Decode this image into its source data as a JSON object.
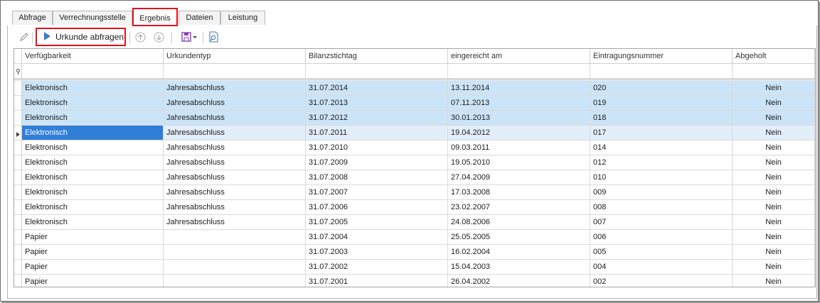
{
  "tabs": [
    {
      "label": "Abfrage"
    },
    {
      "label": "Verrechnungsstelle"
    },
    {
      "label": "Ergebnis"
    },
    {
      "label": "Dateien"
    },
    {
      "label": "Leistung"
    }
  ],
  "active_tab": "Ergebnis",
  "toolbar": {
    "run_label": "Urkunde abfragen",
    "icons": [
      "pencil-icon",
      "play-icon",
      "arrow-up-icon",
      "arrow-down-icon",
      "save-dropdown-icon",
      "search-document-icon"
    ]
  },
  "grid": {
    "columns": [
      "Verfügbarkeit",
      "Urkundentyp",
      "Bilanzstichtag",
      "eingereicht am",
      "Eintragungsnummer",
      "Abgeholt"
    ],
    "rows": [
      [
        "Elektronisch",
        "Jahresabschluss",
        "31.07.2014",
        "13.11.2014",
        "020",
        "Nein"
      ],
      [
        "Elektronisch",
        "Jahresabschluss",
        "31.07.2013",
        "07.11.2013",
        "019",
        "Nein"
      ],
      [
        "Elektronisch",
        "Jahresabschluss",
        "31.07.2012",
        "30.01.2013",
        "018",
        "Nein"
      ],
      [
        "Elektronisch",
        "Jahresabschluss",
        "31.07.2011",
        "19.04.2012",
        "017",
        "Nein"
      ],
      [
        "Elektronisch",
        "Jahresabschluss",
        "31.07.2010",
        "09.03.2011",
        "014",
        "Nein"
      ],
      [
        "Elektronisch",
        "Jahresabschluss",
        "31.07.2009",
        "19.05.2010",
        "012",
        "Nein"
      ],
      [
        "Elektronisch",
        "Jahresabschluss",
        "31.07.2008",
        "27.04.2009",
        "010",
        "Nein"
      ],
      [
        "Elektronisch",
        "Jahresabschluss",
        "31.07.2007",
        "17.03.2008",
        "009",
        "Nein"
      ],
      [
        "Elektronisch",
        "Jahresabschluss",
        "31.07.2006",
        "23.02.2007",
        "008",
        "Nein"
      ],
      [
        "Elektronisch",
        "Jahresabschluss",
        "31.07.2005",
        "24.08.2006",
        "007",
        "Nein"
      ],
      [
        "Papier",
        "",
        "31.07.2004",
        "25.05.2005",
        "006",
        "Nein"
      ],
      [
        "Papier",
        "",
        "31.07.2003",
        "16.02.2004",
        "005",
        "Nein"
      ],
      [
        "Papier",
        "",
        "31.07.2002",
        "15.04.2003",
        "004",
        "Nein"
      ],
      [
        "Papier",
        "",
        "31.07.2001",
        "26.04.2002",
        "002",
        "Nein"
      ]
    ],
    "selected_rows": [
      0,
      1,
      2
    ],
    "focused_row": 3
  },
  "colors": {
    "highlight_border": "#e0141e",
    "selected_row": "#cce4f7",
    "focused_cell": "#2f7ed8",
    "play_icon": "#3b7dc4"
  }
}
